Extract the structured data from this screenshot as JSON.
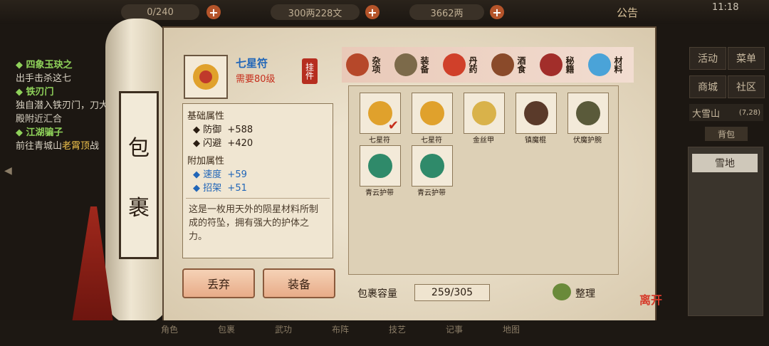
{
  "top": {
    "resource1": "0/240",
    "resource2": "300两228文",
    "resource3": "3662两",
    "notice": "公告",
    "time": "11:18"
  },
  "quests": [
    {
      "title": "四象玉玦之",
      "desc": "出手击杀这七"
    },
    {
      "title": "铁刃门",
      "desc": "独自潜入铁刃门，刀大殿附近汇合"
    },
    {
      "title": "江湖骗子",
      "desc_prefix": "前往青城山",
      "desc_highlight": "老霄顶",
      "desc_suffix": "战"
    }
  ],
  "side": {
    "activity": "活动",
    "menu": "菜单",
    "shop": "商城",
    "community": "社区",
    "location": "大雪山",
    "coords": "(7,28)",
    "bag": "背包",
    "area": "雪地"
  },
  "scroll_title": [
    "包",
    "裹"
  ],
  "item": {
    "name": "七星符",
    "requirement": "需要80级",
    "type_stamp": "挂件",
    "base_header": "基础属性",
    "base_stats": [
      {
        "name": "防御",
        "value": "+588"
      },
      {
        "name": "闪避",
        "value": "+420"
      }
    ],
    "extra_header": "附加属性",
    "extra_stats": [
      {
        "name": "速度",
        "value": "+59"
      },
      {
        "name": "招架",
        "value": "+51"
      }
    ],
    "description": "这是一枚用天外的陨星材料所制成的符坠，拥有强大的护体之力。"
  },
  "tabs": [
    {
      "label": "杂项",
      "icon": "jar-icon",
      "color": "#b6482a"
    },
    {
      "label": "装备",
      "icon": "sword-icon",
      "color": "#7c6a4a"
    },
    {
      "label": "丹药",
      "icon": "pill-icon",
      "color": "#d0402a"
    },
    {
      "label": "酒食",
      "icon": "wine-jar-icon",
      "color": "#8a4a2a"
    },
    {
      "label": "秘籍",
      "icon": "book-icon",
      "color": "#a22e2a"
    },
    {
      "label": "材料",
      "icon": "crystal-icon",
      "color": "#4aa3d8"
    }
  ],
  "buttons": {
    "discard": "丢弃",
    "equip": "装备",
    "sort": "整理"
  },
  "inventory": [
    {
      "name": "七星符",
      "icon": "talisman-icon",
      "equipped": true,
      "color": "#e0a12c"
    },
    {
      "name": "七星符",
      "icon": "talisman-icon",
      "equipped": false,
      "color": "#e0a12c"
    },
    {
      "name": "金丝甲",
      "icon": "armor-icon",
      "equipped": false,
      "color": "#d9b24a"
    },
    {
      "name": "镇魔棍",
      "icon": "staff-icon",
      "equipped": false,
      "color": "#5a3a2a"
    },
    {
      "name": "伏魔护腕",
      "icon": "bracer-icon",
      "equipped": false,
      "color": "#5a5a3a"
    },
    {
      "name": "青云护带",
      "icon": "belt-icon",
      "equipped": false,
      "color": "#2f8a6a"
    },
    {
      "name": "青云护带",
      "icon": "belt-icon",
      "equipped": false,
      "color": "#2f8a6a"
    }
  ],
  "capacity_label": "包裹容量",
  "capacity_value": "259/305",
  "leave": "离开",
  "bottom_nav": [
    "角色",
    "包裹",
    "武功",
    "布阵",
    "技艺",
    "记事",
    "地图"
  ]
}
